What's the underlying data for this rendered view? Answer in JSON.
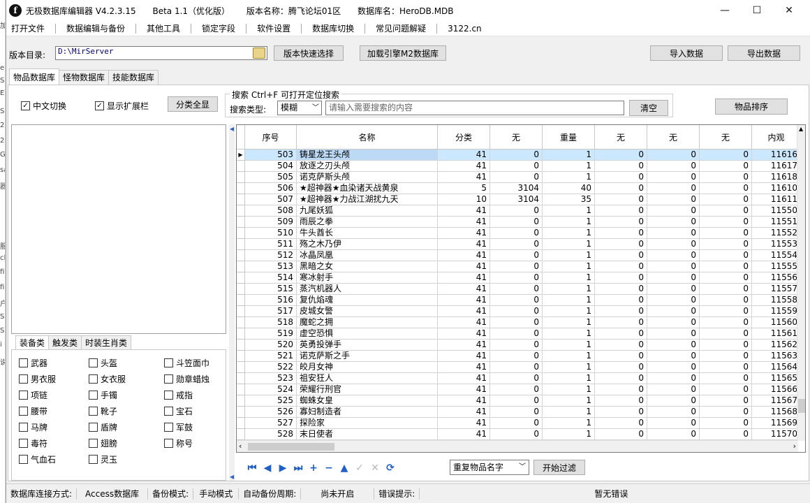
{
  "titlebar": {
    "app": "无极数据库编辑器 V4.2.3.15",
    "beta": "Beta 1.1（优化版）",
    "version_name": "版本名称：腾飞论坛01区",
    "database": "数据库名：HeroDB.MDB",
    "minimize": "—",
    "maximize": "☐",
    "close": "✕"
  },
  "menu": [
    "打开文件",
    "数据编辑与备份",
    "其他工具",
    "锁定字段",
    "软件设置",
    "数据库切换",
    "常见问题解疑",
    "3122.cn"
  ],
  "toolbar": {
    "dir_label": "版本目录:",
    "dir_value": "D:\\MirServer",
    "quick_select": "版本快速选择",
    "load_m2": "加载引擎M2数据库",
    "import": "导入数据",
    "export": "导出数据"
  },
  "tabs": [
    "物品数据库",
    "怪物数据库",
    "技能数据库"
  ],
  "options": {
    "chinese_switch": "中文切换",
    "show_ext": "显示扩展栏",
    "all_categories": "分类全显",
    "search_legend": "搜索   Ctrl+F 可打开定位搜索",
    "search_type_label": "搜索类型:",
    "search_type_value": "模糊",
    "search_placeholder": "请输入需要搜索的内容",
    "clear": "清空",
    "sort_items": "物品排序"
  },
  "left_tabs": [
    "装备类",
    "触发类",
    "时装生肖类"
  ],
  "categories": [
    [
      "武器",
      "头盔",
      "斗笠面巾"
    ],
    [
      "男衣服",
      "女衣服",
      "勋章蜡烛"
    ],
    [
      "项链",
      "手镯",
      "戒指"
    ],
    [
      "腰带",
      "靴子",
      "宝石"
    ],
    [
      "马牌",
      "盾牌",
      "军鼓"
    ],
    [
      "毒符",
      "翅膀",
      "称号"
    ],
    [
      "气血石",
      "灵玉",
      ""
    ]
  ],
  "grid": {
    "headers": [
      "序号",
      "名称",
      "分类",
      "无",
      "重量",
      "无",
      "无",
      "无",
      "内观"
    ],
    "rows": [
      [
        "503",
        "铸星龙王头颅",
        "41",
        "0",
        "1",
        "0",
        "0",
        "0",
        "11616"
      ],
      [
        "504",
        "放逐之刃头颅",
        "41",
        "0",
        "1",
        "0",
        "0",
        "0",
        "11617"
      ],
      [
        "505",
        "诺克萨斯头颅",
        "41",
        "0",
        "1",
        "0",
        "0",
        "0",
        "11618"
      ],
      [
        "506",
        "★超神器★血染诸天战黄泉",
        "5",
        "3104",
        "40",
        "0",
        "0",
        "0",
        "11610"
      ],
      [
        "507",
        "★超神器★力战江湖扰九天",
        "10",
        "3104",
        "35",
        "0",
        "0",
        "0",
        "11611"
      ],
      [
        "508",
        "九尾妖狐",
        "41",
        "0",
        "1",
        "0",
        "0",
        "0",
        "11550"
      ],
      [
        "509",
        "雨辰之拳",
        "41",
        "0",
        "1",
        "0",
        "0",
        "0",
        "11551"
      ],
      [
        "510",
        "牛头酋长",
        "41",
        "0",
        "1",
        "0",
        "0",
        "0",
        "11552"
      ],
      [
        "511",
        "殇之木乃伊",
        "41",
        "0",
        "1",
        "0",
        "0",
        "0",
        "11553"
      ],
      [
        "512",
        "冰晶凤凰",
        "41",
        "0",
        "1",
        "0",
        "0",
        "0",
        "11554"
      ],
      [
        "513",
        "黑暗之女",
        "41",
        "0",
        "1",
        "0",
        "0",
        "0",
        "11555"
      ],
      [
        "514",
        "寒冰射手",
        "41",
        "0",
        "1",
        "0",
        "0",
        "0",
        "11556"
      ],
      [
        "515",
        "蒸汽机器人",
        "41",
        "0",
        "1",
        "0",
        "0",
        "0",
        "11557"
      ],
      [
        "516",
        "复仇焰魂",
        "41",
        "0",
        "1",
        "0",
        "0",
        "0",
        "11558"
      ],
      [
        "517",
        "皮城女警",
        "41",
        "0",
        "1",
        "0",
        "0",
        "0",
        "11559"
      ],
      [
        "518",
        "魔蛇之拥",
        "41",
        "0",
        "1",
        "0",
        "0",
        "0",
        "11560"
      ],
      [
        "519",
        "虚空恐惧",
        "41",
        "0",
        "1",
        "0",
        "0",
        "0",
        "11561"
      ],
      [
        "520",
        "英勇投弹手",
        "41",
        "0",
        "1",
        "0",
        "0",
        "0",
        "11562"
      ],
      [
        "521",
        "诺克萨斯之手",
        "41",
        "0",
        "1",
        "0",
        "0",
        "0",
        "11563"
      ],
      [
        "522",
        "皎月女神",
        "41",
        "0",
        "1",
        "0",
        "0",
        "0",
        "11564"
      ],
      [
        "523",
        "祖安狂人",
        "41",
        "0",
        "1",
        "0",
        "0",
        "0",
        "11565"
      ],
      [
        "524",
        "荣耀行刑官",
        "41",
        "0",
        "1",
        "0",
        "0",
        "0",
        "11566"
      ],
      [
        "525",
        "蜘蛛女皇",
        "41",
        "0",
        "1",
        "0",
        "0",
        "0",
        "11567"
      ],
      [
        "526",
        "寡妇制造者",
        "41",
        "0",
        "1",
        "0",
        "0",
        "0",
        "11568"
      ],
      [
        "527",
        "探险家",
        "41",
        "0",
        "1",
        "0",
        "0",
        "0",
        "11569"
      ],
      [
        "528",
        "末日使者",
        "41",
        "0",
        "1",
        "0",
        "0",
        "0",
        "11570"
      ]
    ]
  },
  "bottom": {
    "dup_select": "重复物品名字",
    "filter": "开始过滤"
  },
  "status": {
    "conn_label": "数据库连接方式:",
    "conn_value": "Access数据库",
    "backup_label": "备份模式:",
    "backup_value": "手动模式",
    "auto_label": "自动备份周期:",
    "auto_value": "尚未开启",
    "err_label": "错误提示:",
    "err_value": "暂无错误"
  },
  "icons": {
    "app": "app-logo-icon",
    "folder": "folder-icon",
    "nav": [
      "first-icon",
      "prior-icon",
      "next-icon",
      "last-icon",
      "insert-icon",
      "delete-icon",
      "edit-icon",
      "post-icon",
      "cancel-icon",
      "refresh-icon"
    ]
  }
}
